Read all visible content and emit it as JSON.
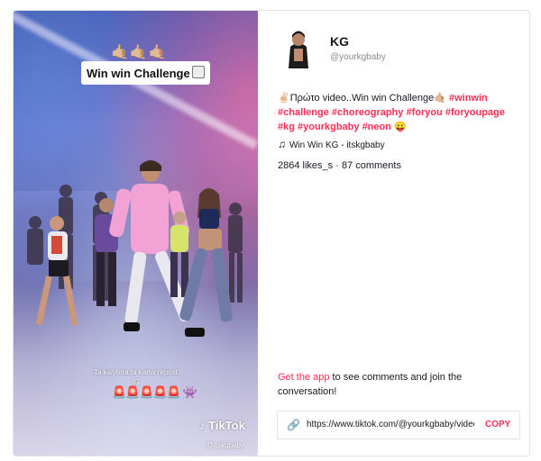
{
  "video": {
    "hands_emojis": "🤙🏼🤙🏼🤙🏼",
    "caption": "Win win Challenge",
    "overlay_line1": "Ta kalytera ta kanw repost",
    "overlay_line2": "IG",
    "emoji_row": "🚨🚨🚨🚨🚨 👾",
    "watermark_brand": "TikTok",
    "watermark_handle": "@itskgbaby"
  },
  "profile": {
    "name": "KG",
    "handle": "@yourkgbaby"
  },
  "post": {
    "desc_prefix": "✌🏻Πρώτο video..Win win Challenge🤙🏼 ",
    "hashtags": [
      "#winwin",
      "#challenge",
      "#choreography",
      "#foryou",
      "#foryoupage",
      "#kg",
      "#yourkgbaby",
      "#neon"
    ],
    "desc_suffix": " 😛",
    "music": "Win Win KG - itskgbaby",
    "likes": "2864 likes_s",
    "comments": "87 comments",
    "stats_sep": " · "
  },
  "cta": {
    "link_text": "Get the app",
    "rest_text": " to see comments and join the conversation!"
  },
  "share": {
    "url": "https://www.tiktok.com/@yourkgbaby/video/",
    "copy_label": "COPY"
  },
  "icons": {
    "music": "music-note-icon",
    "link": "link-icon"
  },
  "colors": {
    "accent": "#fe2c55",
    "text": "#161823",
    "muted": "#8a8b91"
  }
}
